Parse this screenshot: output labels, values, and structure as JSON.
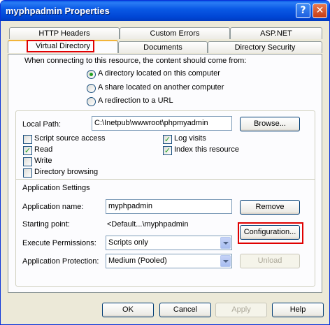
{
  "window": {
    "title": "myphpadmin Properties",
    "help_glyph": "?",
    "close_glyph": "✕"
  },
  "tabs": {
    "row1": [
      "HTTP Headers",
      "Custom Errors",
      "ASP.NET"
    ],
    "row2": [
      "Virtual Directory",
      "Documents",
      "Directory Security"
    ],
    "active": "Virtual Directory"
  },
  "content_source": {
    "prompt": "When connecting to this resource, the content should come from:",
    "options": [
      {
        "label": "A directory located on this computer",
        "selected": true
      },
      {
        "label": "A share located on another computer",
        "selected": false
      },
      {
        "label": "A redirection to a URL",
        "selected": false
      }
    ]
  },
  "local_path": {
    "label": "Local Path:",
    "value": "C:\\Inetpub\\wwwroot\\phpmyadmin",
    "browse_label": "Browse..."
  },
  "permissions": {
    "script_source_access": {
      "label": "Script source access",
      "checked": false
    },
    "read": {
      "label": "Read",
      "checked": true
    },
    "write": {
      "label": "Write",
      "checked": false
    },
    "directory_browsing": {
      "label": "Directory browsing",
      "checked": false
    },
    "log_visits": {
      "label": "Log visits",
      "checked": true
    },
    "index_resource": {
      "label": "Index this resource",
      "checked": true
    }
  },
  "app_settings": {
    "heading": "Application Settings",
    "name_label": "Application name:",
    "name_value": "myphpadmin",
    "remove_label": "Remove",
    "starting_point_label": "Starting point:",
    "starting_point_value": "<Default...\\myphpadmin",
    "configuration_label": "Configuration...",
    "exec_perm_label": "Execute Permissions:",
    "exec_perm_value": "Scripts only",
    "protection_label": "Application Protection:",
    "protection_value": "Medium (Pooled)",
    "unload_label": "Unload"
  },
  "footer": {
    "ok": "OK",
    "cancel": "Cancel",
    "apply": "Apply",
    "help": "Help"
  },
  "colors": {
    "highlight_box": "#e00000",
    "title_bar": "#0a5ae6",
    "dialog_bg": "#ece9d8"
  },
  "check_glyph": "✓"
}
